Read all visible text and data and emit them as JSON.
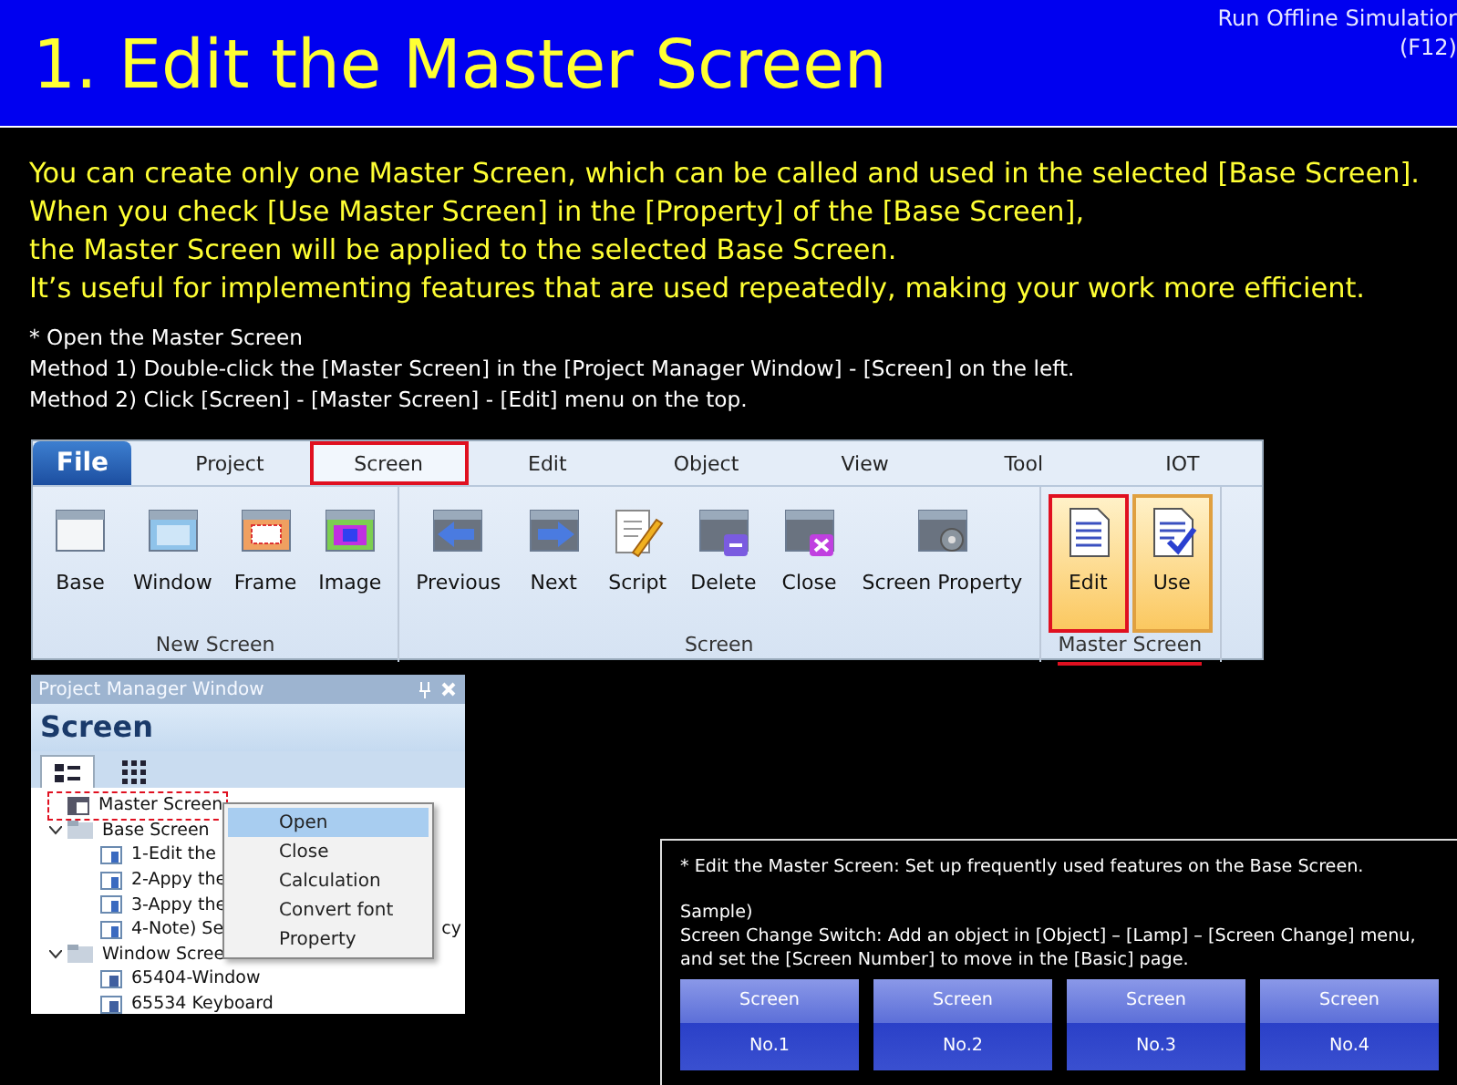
{
  "header": {
    "title": "1. Edit the Master Screen",
    "shortcut_lines": [
      "Run Offline Simulatior",
      "(F12)"
    ]
  },
  "intro_lines": [
    "You can create only one Master Screen, which can be called and used in the selected [Base Screen].",
    "When you check [Use Master Screen] in the [Property] of the [Base Screen],",
    "the Master Screen will be applied to the selected Base Screen.",
    "It’s useful for implementing features that are used repeatedly, making your work more efficient."
  ],
  "notes": [
    "* Open the Master Screen",
    "Method 1) Double-click the [Master Screen] in the [Project Manager Window] - [Screen] on the left.",
    "Method 2) Click [Screen] - [Master Screen] - [Edit] menu on the top."
  ],
  "ribbon": {
    "tabs": [
      {
        "label": "File",
        "kind": "file",
        "selected": false,
        "highlighted": false
      },
      {
        "label": "Project",
        "kind": "tab",
        "selected": false,
        "highlighted": false
      },
      {
        "label": "Screen",
        "kind": "tab",
        "selected": true,
        "highlighted": true
      },
      {
        "label": "Edit",
        "kind": "tab",
        "selected": false,
        "highlighted": false
      },
      {
        "label": "Object",
        "kind": "tab",
        "selected": false,
        "highlighted": false
      },
      {
        "label": "View",
        "kind": "tab",
        "selected": false,
        "highlighted": false
      },
      {
        "label": "Tool",
        "kind": "tab",
        "selected": false,
        "highlighted": false
      },
      {
        "label": "IOT",
        "kind": "tab",
        "selected": false,
        "highlighted": false
      }
    ],
    "groups": [
      {
        "label": "New Screen",
        "underlined": false,
        "buttons": [
          {
            "label": "Base",
            "active": false,
            "highlighted": false
          },
          {
            "label": "Window",
            "active": false,
            "highlighted": false
          },
          {
            "label": "Frame",
            "active": false,
            "highlighted": false
          },
          {
            "label": "Image",
            "active": false,
            "highlighted": false
          }
        ]
      },
      {
        "label": "Screen",
        "underlined": false,
        "buttons": [
          {
            "label": "Previous",
            "active": false,
            "highlighted": false
          },
          {
            "label": "Next",
            "active": false,
            "highlighted": false
          },
          {
            "label": "Script",
            "active": false,
            "highlighted": false
          },
          {
            "label": "Delete",
            "active": false,
            "highlighted": false
          },
          {
            "label": "Close",
            "active": false,
            "highlighted": false
          },
          {
            "label": "Screen Property",
            "active": false,
            "highlighted": false
          }
        ]
      },
      {
        "label": "Master Screen",
        "underlined": true,
        "buttons": [
          {
            "label": "Edit",
            "active": true,
            "highlighted": true
          },
          {
            "label": "Use",
            "active": true,
            "highlighted": false
          }
        ]
      }
    ]
  },
  "project_manager": {
    "title": "Project Manager Window",
    "heading": "Screen",
    "view_tabs": [
      {
        "kind": "list",
        "selected": true
      },
      {
        "kind": "grid",
        "selected": false
      }
    ],
    "tree": [
      {
        "label": "Master Screen",
        "kind": "master",
        "highlighted": true,
        "expanded": false
      },
      {
        "label": "Base Screen",
        "kind": "folder",
        "highlighted": false,
        "expanded": true,
        "children": [
          {
            "label": "1-Edit the",
            "kind": "base"
          },
          {
            "label": "2-Appy the",
            "kind": "base"
          },
          {
            "label": "3-Appy the",
            "kind": "base"
          },
          {
            "label": "4-Note) Se",
            "kind": "base",
            "tail": "cy"
          }
        ]
      },
      {
        "label": "Window Scree",
        "kind": "folder",
        "highlighted": false,
        "expanded": true,
        "children": [
          {
            "label": "65404-Window",
            "kind": "window"
          },
          {
            "label": "65534 Keyboard",
            "kind": "window"
          }
        ]
      }
    ],
    "context_menu": [
      {
        "label": "Open",
        "selected": true
      },
      {
        "label": "Close",
        "selected": false
      },
      {
        "label": "Calculation",
        "selected": false
      },
      {
        "label": "Convert font",
        "selected": false
      },
      {
        "label": "Property",
        "selected": false
      }
    ]
  },
  "sample": {
    "note": "* Edit the Master Screen: Set up frequently used features on the Base Screen.",
    "lines": [
      "Sample)",
      "Screen Change Switch: Add an object in [Object] – [Lamp] – [Screen Change] menu,",
      "and set the [Screen Number] to move in the [Basic] page."
    ],
    "switches": [
      {
        "top": "Screen",
        "bottom": "No.1",
        "pressed": false
      },
      {
        "top": "Screen",
        "bottom": "No.2",
        "pressed": false
      },
      {
        "top": "Screen",
        "bottom": "No.3",
        "pressed": false
      },
      {
        "top": "Screen",
        "bottom": "No.4",
        "pressed": false
      }
    ]
  }
}
